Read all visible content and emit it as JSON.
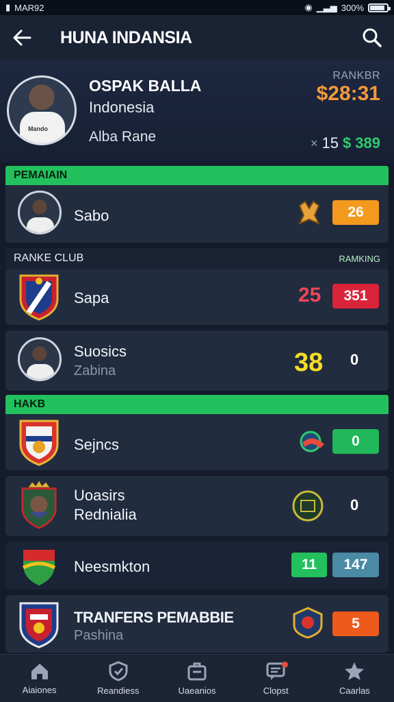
{
  "status_bar": {
    "left_text": "MAR92",
    "right_text": "300%",
    "battery_level": 0.8
  },
  "app_bar": {
    "title": "HUNA INDANSIA"
  },
  "profile": {
    "name": "OSPAK BALLA",
    "country": "Indonesia",
    "role": "Alba Rane",
    "rank_label": "RANKBR",
    "rank_value": "$28:31",
    "stat_a": "15",
    "stat_b": "$ 389",
    "shirt_text": "Mando"
  },
  "sections": {
    "pemain": "PEMAIAIN",
    "ranke_club": "RANKE CLUB",
    "ranking": "RAMKING",
    "hakb": "HAKB"
  },
  "rows": {
    "r1": {
      "label": "Sabo",
      "badge": "26",
      "badge_color": "#f39a1e"
    },
    "r2": {
      "label": "Sapa",
      "value": "25",
      "value_color": "#f0455a",
      "badge": "351",
      "badge_color": "#d9243a"
    },
    "r3": {
      "label": "Suosics",
      "sub": "Zabina",
      "value": "38",
      "value_color": "#f4de24",
      "plain": "0"
    },
    "r4": {
      "label": "Sejncs",
      "badge": "0",
      "badge_color": "#20b85a"
    },
    "r5": {
      "label": "Uoasirs",
      "label2": "Rednialia",
      "plain": "0"
    },
    "r6": {
      "label": "Neesmkton",
      "badge1": "11",
      "badge1_color": "#22c15e",
      "badge2": "147",
      "badge2_color": "#4a8aa4"
    },
    "r7": {
      "label": "TRANFERS PEMABBIE",
      "sub": "Pashina",
      "badge": "5",
      "badge_color": "#ee5a1c"
    }
  },
  "tabs": [
    {
      "label": "Aiaiones",
      "icon": "home-icon"
    },
    {
      "label": "Reandiess",
      "icon": "shield-icon"
    },
    {
      "label": "Uaeanios",
      "icon": "briefcase-icon"
    },
    {
      "label": "Clopst",
      "icon": "chat-icon"
    },
    {
      "label": "Caarlas",
      "icon": "star-icon"
    }
  ]
}
